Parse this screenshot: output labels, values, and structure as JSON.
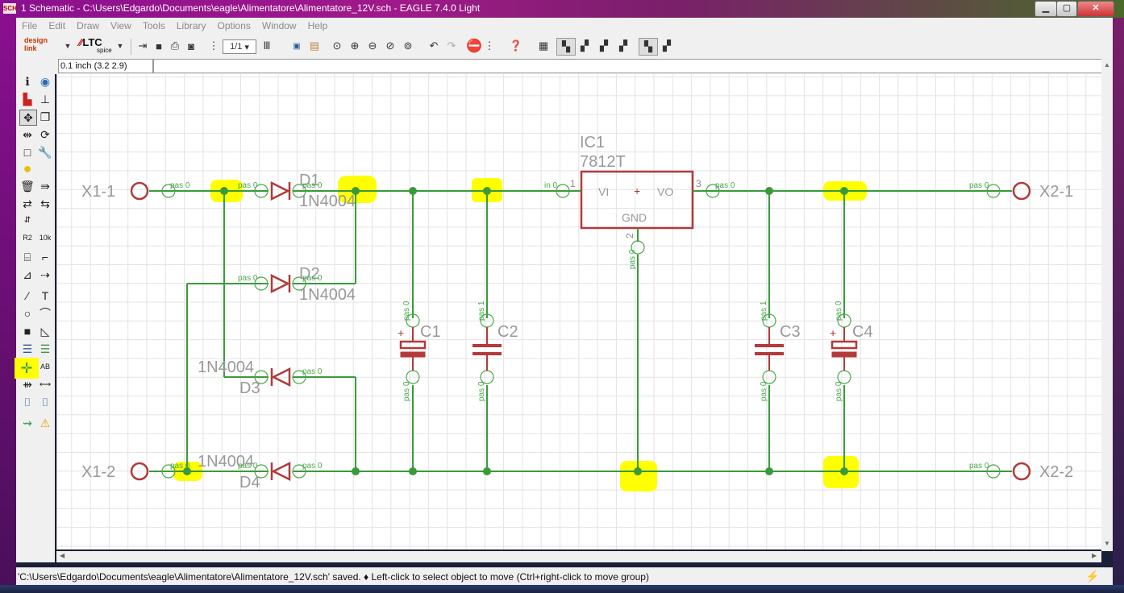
{
  "window": {
    "title": "1 Schematic - C:\\Users\\Edgardo\\Documents\\eagle\\Alimentatore\\Alimentatore_12V.sch - EAGLE 7.4.0 Light",
    "app_icon": "SCH",
    "buttons": {
      "minimize": "▁",
      "maximize": "▢",
      "close": "✕"
    }
  },
  "menu": [
    "File",
    "Edit",
    "Draw",
    "View",
    "Tools",
    "Library",
    "Options",
    "Window",
    "Help"
  ],
  "toolbar": {
    "designlink_label": "design link",
    "ltc_label": "LTC",
    "ltc_sub": "spice",
    "sheet_select": "1/1"
  },
  "coord_display": "0.1 inch (3.2 2.9)",
  "status_message": "'C:\\Users\\Edgardo\\Documents\\eagle\\Alimentatore\\Alimentatore_12V.sch' saved.  ♦ Left-click to select object to move (Ctrl+right-click to move group)",
  "schematic": {
    "ic": {
      "name": "IC1",
      "value": "7812T",
      "pin_in": "VI",
      "pin_out": "VO",
      "pin_gnd": "GND",
      "pin1": "1",
      "pin2": "2",
      "pin3": "3",
      "pin_in_label": "in 0"
    },
    "connectors": {
      "x1_1": "X1-1",
      "x1_2": "X1-2",
      "x2_1": "X2-1",
      "x2_2": "X2-2"
    },
    "diodes": {
      "d1_name": "D1",
      "d1_value": "1N4004",
      "d2_name": "D2",
      "d2_value": "1N4004",
      "d3_name": "D3",
      "d3_value": "1N4004",
      "d4_name": "D4",
      "d4_value": "1N4004"
    },
    "caps": {
      "c1": "C1",
      "c2": "C2",
      "c3": "C3",
      "c4": "C4"
    },
    "pin_labels": {
      "pas0": "pas 0",
      "pas1": "pas 1",
      "plus": "+"
    },
    "colors": {
      "wire": "#3a9a3a",
      "symbol": "#b23a3a",
      "label": "#888888",
      "pin": "#4aa84a",
      "highlight": "#ffff00"
    }
  }
}
